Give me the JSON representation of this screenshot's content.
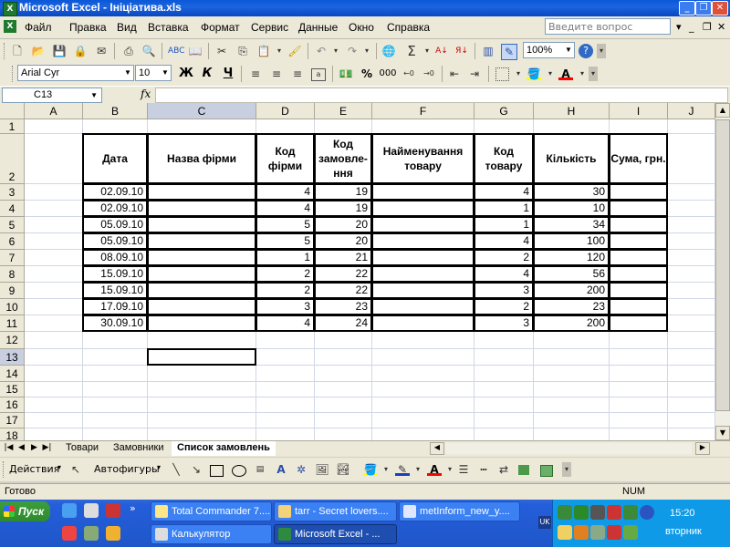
{
  "window": {
    "title": "Microsoft Excel - Ініціатива.xls",
    "app_icon": "excel-icon"
  },
  "menu": {
    "items": [
      "Файл",
      "Правка",
      "Вид",
      "Вставка",
      "Формат",
      "Сервис",
      "Данные",
      "Окно",
      "Справка"
    ],
    "help_placeholder": "Введите вопрос"
  },
  "standard_toolbar": {
    "zoom": "100%"
  },
  "formatting_toolbar": {
    "font": "Arial Cyr",
    "size": "10",
    "bold": "Ж",
    "italic": "К",
    "underline": "Ч",
    "percent": "%",
    "thousands": "000"
  },
  "formula_bar": {
    "name_box": "C13",
    "fx": "fx",
    "value": ""
  },
  "columns": [
    "A",
    "B",
    "C",
    "D",
    "E",
    "F",
    "G",
    "H",
    "I",
    "J"
  ],
  "rows": [
    "1",
    "2",
    "3",
    "4",
    "5",
    "6",
    "7",
    "8",
    "9",
    "10",
    "11",
    "12",
    "13",
    "14",
    "15",
    "16",
    "17",
    "18"
  ],
  "table": {
    "headers": [
      "Дата",
      "Назва фірми",
      "Код фірми",
      "Код замовле-ння",
      "Найменування товару",
      "Код товару",
      "Кількість",
      "Сума, грн."
    ],
    "rows": [
      [
        "02.09.10",
        "",
        "4",
        "19",
        "",
        "4",
        "30",
        ""
      ],
      [
        "02.09.10",
        "",
        "4",
        "19",
        "",
        "1",
        "10",
        ""
      ],
      [
        "05.09.10",
        "",
        "5",
        "20",
        "",
        "1",
        "34",
        ""
      ],
      [
        "05.09.10",
        "",
        "5",
        "20",
        "",
        "4",
        "100",
        ""
      ],
      [
        "08.09.10",
        "",
        "1",
        "21",
        "",
        "2",
        "120",
        ""
      ],
      [
        "15.09.10",
        "",
        "2",
        "22",
        "",
        "4",
        "56",
        ""
      ],
      [
        "15.09.10",
        "",
        "2",
        "22",
        "",
        "3",
        "200",
        ""
      ],
      [
        "17.09.10",
        "",
        "3",
        "23",
        "",
        "2",
        "23",
        ""
      ],
      [
        "30.09.10",
        "",
        "4",
        "24",
        "",
        "3",
        "200",
        ""
      ]
    ]
  },
  "sheet_tabs": [
    "Товари",
    "Замовники",
    "Список замовлень"
  ],
  "drawing_toolbar": {
    "actions": "Действия",
    "autoshapes": "Автофигуры"
  },
  "status": {
    "left": "Готово",
    "num": "NUM"
  },
  "taskbar": {
    "start": "Пуск",
    "tasks": [
      {
        "label": "Total Commander 7...."
      },
      {
        "label": "tarr - Secret lovers...."
      },
      {
        "label": "metInform_new_y...."
      },
      {
        "label": "Калькулятор"
      },
      {
        "label": "Microsoft Excel - ..."
      }
    ],
    "lang": "UK",
    "clock": "15:20",
    "day": "вторник"
  }
}
